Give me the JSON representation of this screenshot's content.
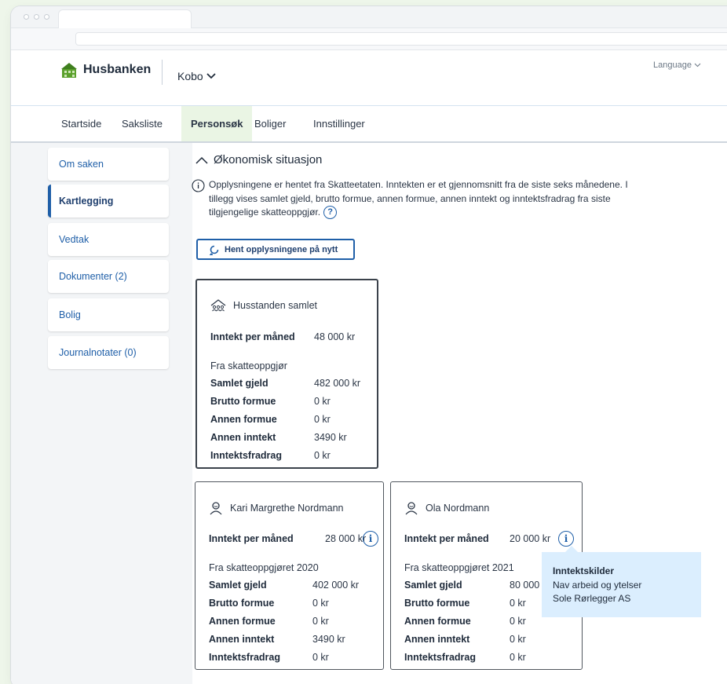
{
  "header": {
    "brand": "Husbanken",
    "app_switcher": "Kobo",
    "language": "Language"
  },
  "nav": {
    "items": [
      {
        "label": "Startside"
      },
      {
        "label": "Saksliste"
      },
      {
        "label": "Personsøk",
        "active": true
      },
      {
        "label": "Boliger"
      },
      {
        "label": "Innstillinger"
      }
    ]
  },
  "sidebar": {
    "items": [
      {
        "label": "Om saken"
      },
      {
        "label": "Kartlegging",
        "active": true
      },
      {
        "label": "Vedtak"
      },
      {
        "label": "Dokumenter (2)"
      },
      {
        "label": "Bolig"
      },
      {
        "label": "Journalnotater (0)"
      }
    ]
  },
  "main": {
    "section_title": "Økonomisk situasjon",
    "info_text": "Opplysningene er hentet fra Skatteetaten. Inntekten er et gjennomsnitt fra de siste seks månedene. I tillegg vises samlet gjeld, brutto formue, annen formue, annen inntekt og inntektsfradrag fra siste tilgjengelige skatteoppgjør.",
    "refetch_button": "Hent opplysningene på nytt"
  },
  "household": {
    "title": "Husstanden samlet",
    "income_label": "Inntekt per måned",
    "income_value": "48 000 kr",
    "source": "Fra skatteoppgjør",
    "rows": [
      {
        "label": "Samlet gjeld",
        "value": "482 000 kr"
      },
      {
        "label": "Brutto formue",
        "value": "0 kr"
      },
      {
        "label": "Annen formue",
        "value": "0 kr"
      },
      {
        "label": "Annen inntekt",
        "value": "3490 kr"
      },
      {
        "label": "Inntektsfradrag",
        "value": "0 kr"
      }
    ]
  },
  "persons": [
    {
      "name": "Kari Margrethe Nordmann",
      "income_label": "Inntekt per måned",
      "income_value": "28 000 kr",
      "source": "Fra skatteoppgjøret 2020",
      "rows": [
        {
          "label": "Samlet gjeld",
          "value": "402 000 kr"
        },
        {
          "label": "Brutto formue",
          "value": "0 kr"
        },
        {
          "label": "Annen formue",
          "value": "0 kr"
        },
        {
          "label": "Annen inntekt",
          "value": "3490 kr"
        },
        {
          "label": "Inntektsfradrag",
          "value": "0 kr"
        }
      ]
    },
    {
      "name": "Ola Nordmann",
      "income_label": "Inntekt per måned",
      "income_value": "20 000 kr",
      "source": "Fra skatteoppgjøret 2021",
      "rows": [
        {
          "label": "Samlet gjeld",
          "value": "80 000"
        },
        {
          "label": "Brutto formue",
          "value": "0 kr"
        },
        {
          "label": "Annen formue",
          "value": "0 kr"
        },
        {
          "label": "Annen inntekt",
          "value": "0 kr"
        },
        {
          "label": "Inntektsfradrag",
          "value": "0 kr"
        }
      ]
    }
  ],
  "tooltip": {
    "title": "Inntektskilder",
    "lines": [
      "Nav arbeid og ytelser",
      "Sole Rørlegger AS"
    ]
  },
  "colors": {
    "accent": "#1f5fa8",
    "active_tab_bg": "#eaf5e4",
    "tooltip_bg": "#dbeefe",
    "logo_green": "#5aa02c"
  },
  "icons": {
    "collapse": "chevron-up-icon",
    "info": "info-icon",
    "help": "question-icon",
    "refresh": "refresh-icon",
    "household": "household-icon",
    "person": "person-icon",
    "dropdown": "chevron-down-icon"
  }
}
